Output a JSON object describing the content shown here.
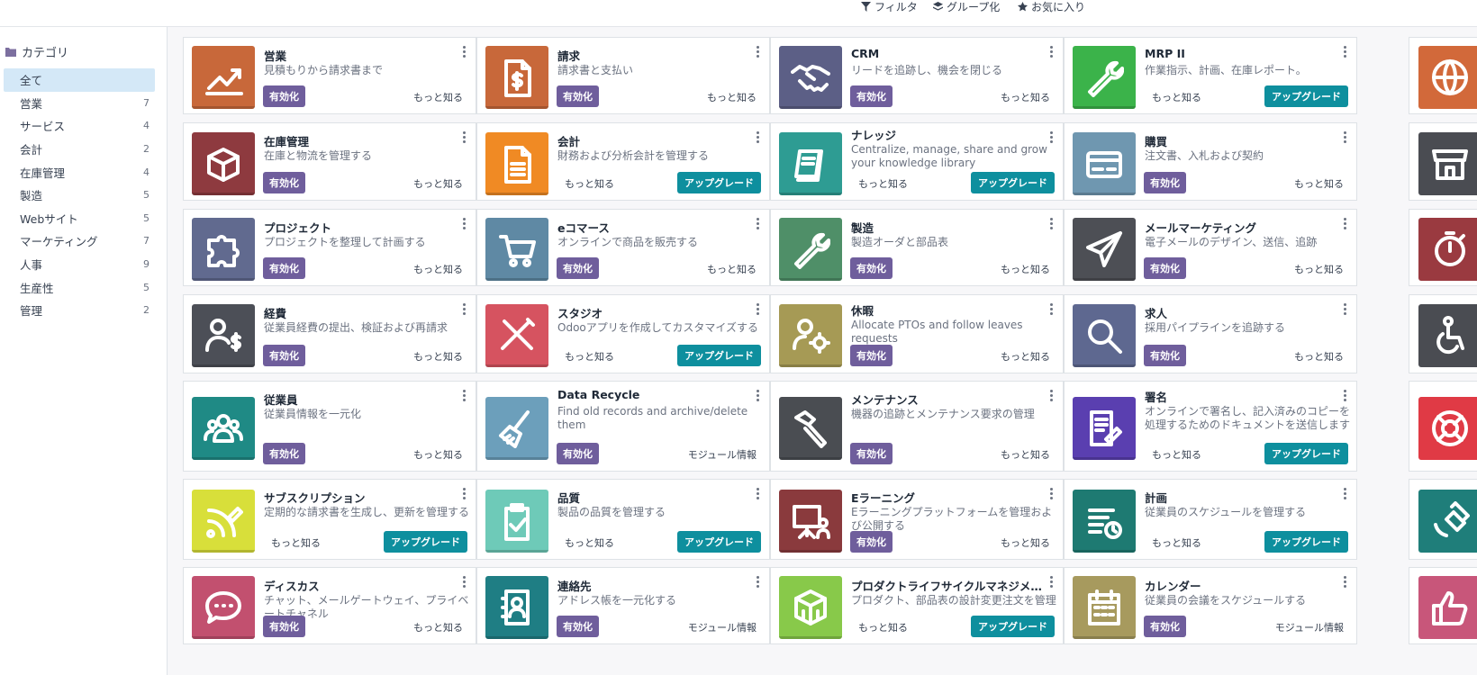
{
  "topbar": {
    "filter_label": "フィルタ",
    "group_label": "グループ化",
    "favorites_label": "お気に入り"
  },
  "sidebar": {
    "heading": "カテゴリ",
    "items": [
      {
        "label": "全て",
        "count": ""
      },
      {
        "label": "営業",
        "count": "7"
      },
      {
        "label": "サービス",
        "count": "4"
      },
      {
        "label": "会計",
        "count": "2"
      },
      {
        "label": "在庫管理",
        "count": "4"
      },
      {
        "label": "製造",
        "count": "5"
      },
      {
        "label": "Webサイト",
        "count": "5"
      },
      {
        "label": "マーケティング",
        "count": "7"
      },
      {
        "label": "人事",
        "count": "9"
      },
      {
        "label": "生産性",
        "count": "5"
      },
      {
        "label": "管理",
        "count": "2"
      }
    ]
  },
  "labels": {
    "activate": "有効化",
    "learn_more": "もっと知る",
    "upgrade": "アップグレード",
    "module_info": "モジュール情報"
  },
  "apps": [
    {
      "title": "営業",
      "desc": "見積もりから請求書まで",
      "variant": "activate",
      "link": "learn_more",
      "color": "#c8683a",
      "icon": "chart-icon"
    },
    {
      "title": "請求",
      "desc": "請求書と支払い",
      "variant": "activate",
      "link": "learn_more",
      "color": "#c8683a",
      "icon": "invoice-icon"
    },
    {
      "title": "CRM",
      "desc": "リードを追跡し、機会を閉じる",
      "variant": "activate",
      "link": "learn_more",
      "color": "#5c5f86",
      "icon": "handshake-icon"
    },
    {
      "title": "MRP II",
      "desc": "作業指示、計画、在庫レポート。",
      "variant": "upgrade",
      "link": "learn_more",
      "color": "#3bb34a",
      "icon": "wrench-icon"
    },
    {
      "title": "在庫管理",
      "desc": "在庫と物流を管理する",
      "variant": "activate",
      "link": "learn_more",
      "color": "#8e3a3f",
      "icon": "box-icon"
    },
    {
      "title": "会計",
      "desc": "財務および分析会計を管理する",
      "variant": "upgrade",
      "link": "learn_more",
      "color": "#f08a24",
      "icon": "document-icon"
    },
    {
      "title": "ナレッジ",
      "desc": "Centralize, manage, share and grow your knowledge library",
      "variant": "upgrade",
      "link": "learn_more",
      "color": "#2e9c93",
      "icon": "book-icon"
    },
    {
      "title": "購買",
      "desc": "注文書、入札および契約",
      "variant": "activate",
      "link": "learn_more",
      "color": "#6f97b0",
      "icon": "card-icon"
    },
    {
      "title": "プロジェクト",
      "desc": "プロジェクトを整理して計画する",
      "variant": "activate",
      "link": "learn_more",
      "color": "#616a8f",
      "icon": "puzzle-icon"
    },
    {
      "title": "eコマース",
      "desc": "オンラインで商品を販売する",
      "variant": "activate",
      "link": "learn_more",
      "color": "#5f89a4",
      "icon": "cart-icon"
    },
    {
      "title": "製造",
      "desc": "製造オーダと部品表",
      "variant": "activate",
      "link": "learn_more",
      "color": "#4f8f68",
      "icon": "wrench-icon"
    },
    {
      "title": "メールマーケティング",
      "desc": "電子メールのデザイン、送信、追跡",
      "variant": "activate",
      "link": "learn_more",
      "color": "#4d4f55",
      "icon": "paper-plane-icon"
    },
    {
      "title": "経費",
      "desc": "従業員経費の提出、検証および再請求",
      "variant": "activate",
      "link": "learn_more",
      "color": "#4c4f57",
      "icon": "expense-user-icon"
    },
    {
      "title": "スタジオ",
      "desc": "Odooアプリを作成してカスタマイズする",
      "variant": "upgrade",
      "link": "learn_more",
      "color": "#d65360",
      "icon": "tools-icon"
    },
    {
      "title": "休暇",
      "desc": "Allocate PTOs and follow leaves requests",
      "variant": "activate",
      "link": "learn_more",
      "color": "#a69a55",
      "icon": "user-gear-icon"
    },
    {
      "title": "求人",
      "desc": "採用パイプラインを追跡する",
      "variant": "activate",
      "link": "learn_more",
      "color": "#5e6890",
      "icon": "magnifier-icon"
    },
    {
      "title": "従業員",
      "desc": "従業員情報を一元化",
      "variant": "activate",
      "link": "learn_more",
      "color": "#1f8a85",
      "icon": "users-icon"
    },
    {
      "title": "Data Recycle",
      "desc": "Find old records and archive/delete them",
      "variant": "activate",
      "link": "module_info",
      "color": "#6c9fbb",
      "icon": "broom-icon"
    },
    {
      "title": "メンテナンス",
      "desc": "機器の追跡とメンテナンス要求の管理",
      "variant": "activate",
      "link": "learn_more",
      "color": "#4a4d52",
      "icon": "hammer-icon"
    },
    {
      "title": "署名",
      "desc": "オンラインで署名し、記入済みのコピーを処理するためのドキュメントを送信します",
      "variant": "upgrade",
      "link": "learn_more",
      "color": "#5a3fb0",
      "icon": "signature-icon"
    },
    {
      "title": "サブスクリプション",
      "desc": "定期的な請求書を生成し、更新を管理する",
      "variant": "upgrade",
      "link": "learn_more",
      "color": "#d8df3a",
      "icon": "rss-pen-icon"
    },
    {
      "title": "品質",
      "desc": "製品の品質を管理する",
      "variant": "upgrade",
      "link": "learn_more",
      "color": "#6ecab8",
      "icon": "clipboard-check-icon"
    },
    {
      "title": "Eラーニング",
      "desc": "Eラーニングプラットフォームを管理および公開する",
      "variant": "activate",
      "link": "learn_more",
      "color": "#8a3a3d",
      "icon": "presentation-icon"
    },
    {
      "title": "計画",
      "desc": "従業員のスケジュールを管理する",
      "variant": "upgrade",
      "link": "learn_more",
      "color": "#1e7a72",
      "icon": "schedule-icon"
    },
    {
      "title": "ディスカス",
      "desc": "チャット、メールゲートウェイ、プライベートチャネル",
      "variant": "activate",
      "link": "learn_more",
      "color": "#c2506f",
      "icon": "chat-icon"
    },
    {
      "title": "連絡先",
      "desc": "アドレス帳を一元化する",
      "variant": "activate",
      "link": "module_info",
      "color": "#1f7e84",
      "icon": "contacts-icon"
    },
    {
      "title": "プロダクトライフサイクルマネジメ…",
      "desc": "プロダクト、部品表の設計変更注文を管理",
      "variant": "upgrade",
      "link": "learn_more",
      "color": "#88c94a",
      "icon": "cube-icon"
    },
    {
      "title": "カレンダー",
      "desc": "従業員の会議をスケジュールする",
      "variant": "activate",
      "link": "module_info",
      "color": "#a79a5e",
      "icon": "calendar-icon"
    }
  ],
  "peek_apps": [
    {
      "color": "#d2693a",
      "icon": "globe-icon"
    },
    {
      "color": "#4a4c52",
      "icon": "store-icon"
    },
    {
      "color": "#9a3a40",
      "icon": "stopwatch-icon"
    },
    {
      "color": "#4a4c52",
      "icon": "accessibility-icon"
    },
    {
      "color": "#e03a45",
      "icon": "lifebuoy-icon"
    },
    {
      "color": "#1f7e7a",
      "icon": "satellite-icon"
    },
    {
      "color": "#c8567a",
      "icon": "thumbs-up-icon"
    }
  ]
}
